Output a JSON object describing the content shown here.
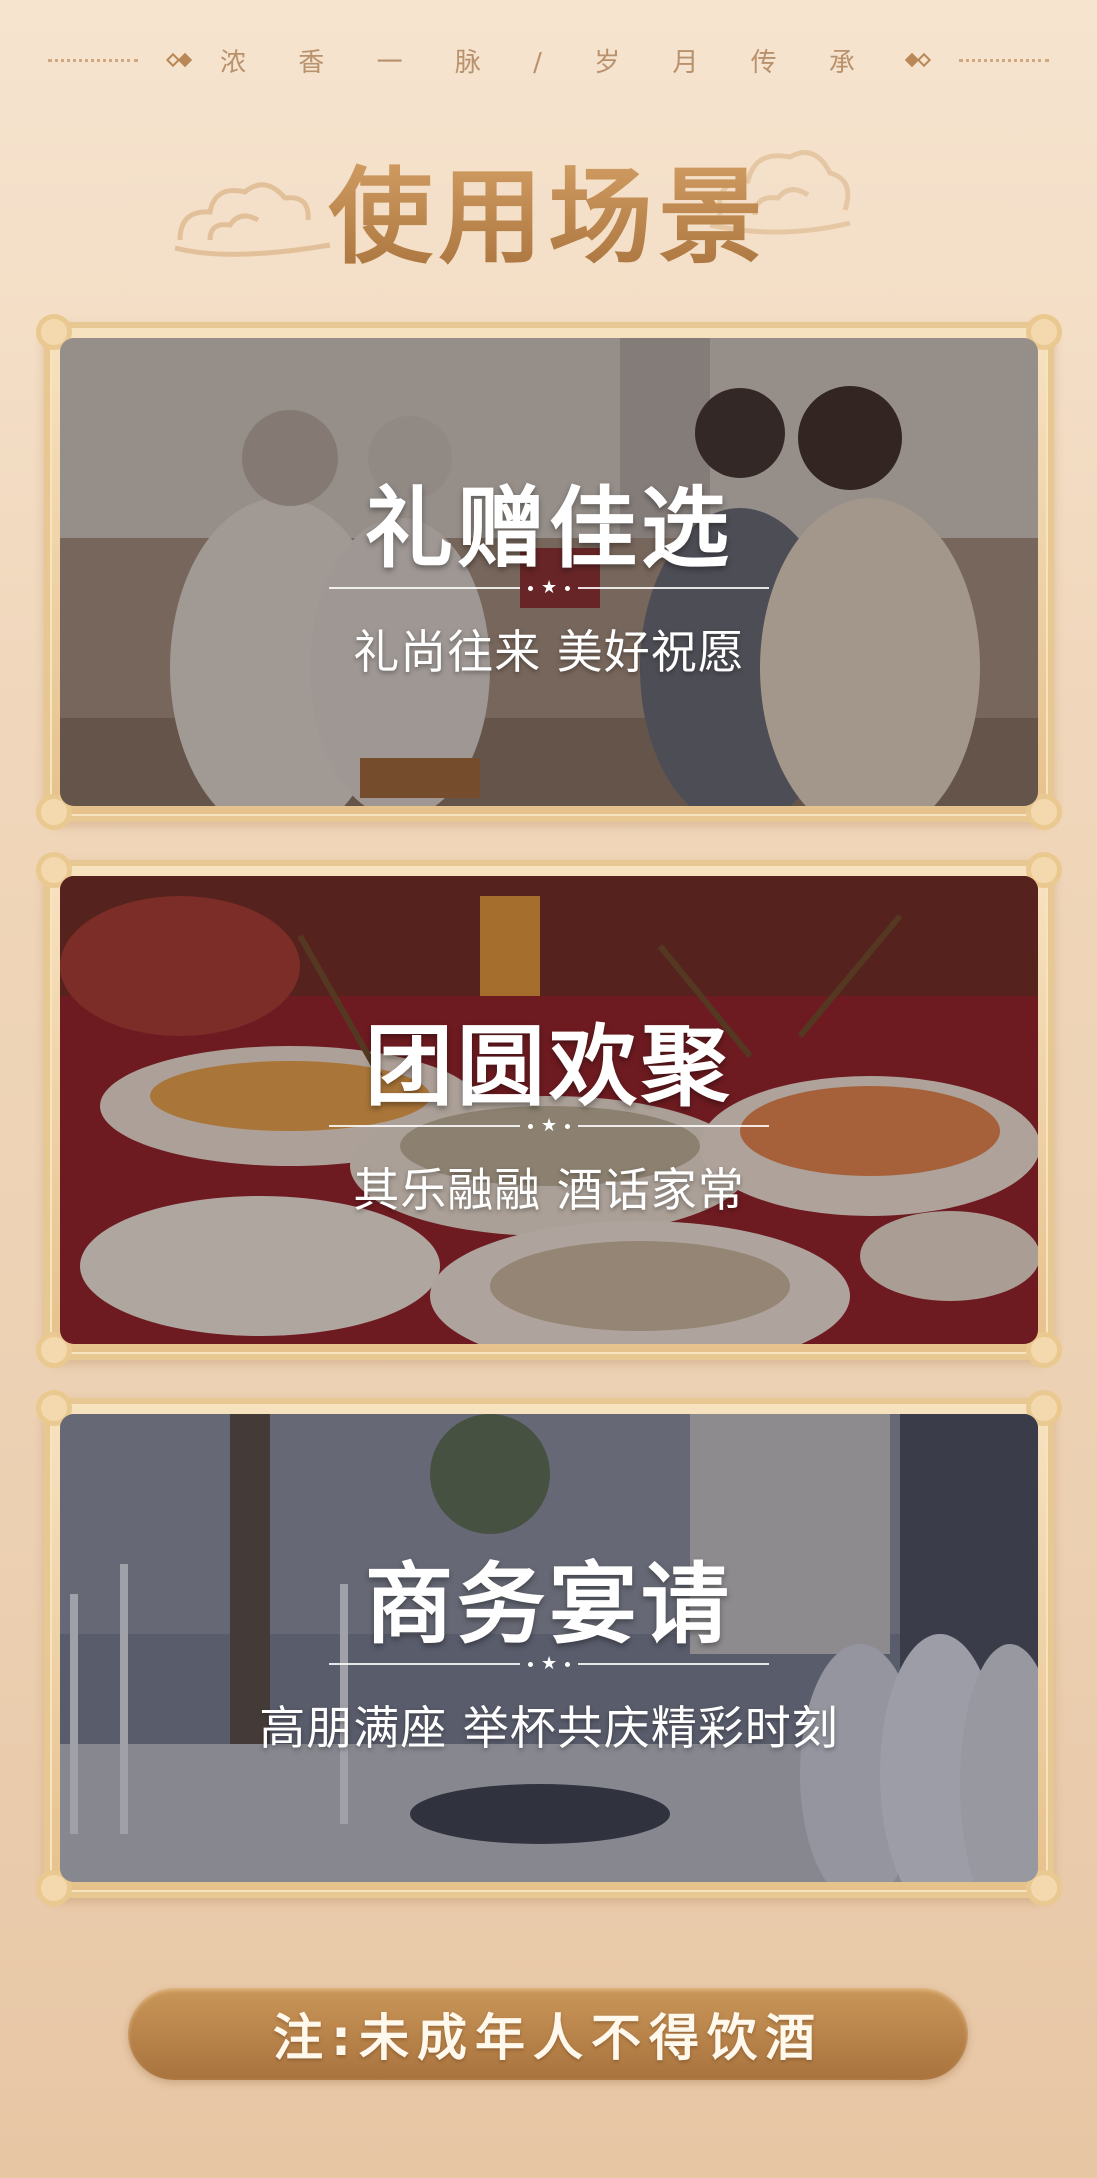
{
  "header": {
    "slogan": "浓 香 一 脉 / 岁 月 传 承",
    "title": "使用场景"
  },
  "scenes": [
    {
      "title": "礼赠佳选",
      "subtitle": "礼尚往来 美好祝愿",
      "photo_theme": "family-gift-giving"
    },
    {
      "title": "团圆欢聚",
      "subtitle": "其乐融融 酒话家常",
      "photo_theme": "reunion-dinner-table"
    },
    {
      "title": "商务宴请",
      "subtitle": "高朋满座 举杯共庆精彩时刻",
      "photo_theme": "business-banquet-hall"
    }
  ],
  "notice": {
    "text": "注:未成年人不得饮酒"
  },
  "colors": {
    "background_top": "#f6e4cf",
    "background_bottom": "#e7c6a4",
    "title_gold": "#b98145",
    "frame_gold": "#e7c792",
    "notice_bg": "#b8824a"
  },
  "icons": [
    "cloud-icon",
    "diamond-icon",
    "star-icon"
  ]
}
